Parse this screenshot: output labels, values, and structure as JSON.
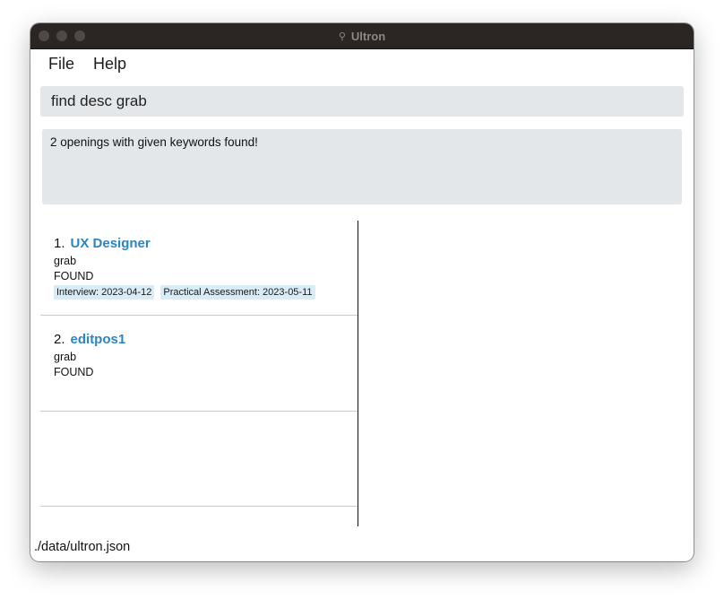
{
  "window": {
    "title": "Ultron",
    "title_icon": "⚲"
  },
  "menubar": {
    "items": [
      {
        "label": "File"
      },
      {
        "label": "Help"
      }
    ]
  },
  "command": {
    "value": "find desc grab",
    "placeholder": ""
  },
  "result": {
    "text": "2 openings with given keywords found!"
  },
  "openings": [
    {
      "index": "1.",
      "title": "UX Designer",
      "description": "grab",
      "status": "FOUND",
      "tags": [
        "Interview: 2023-04-12",
        "Practical Assessment: 2023-05-11"
      ]
    },
    {
      "index": "2.",
      "title": "editpos1",
      "description": "grab",
      "status": "FOUND",
      "tags": []
    }
  ],
  "status_bar": {
    "path": "./data/ultron.json"
  },
  "colors": {
    "titlebar": "#2b2523",
    "accent_title": "#2a86c0",
    "tag_bg": "#d7ecf7",
    "field_bg": "#e4e7ea"
  }
}
